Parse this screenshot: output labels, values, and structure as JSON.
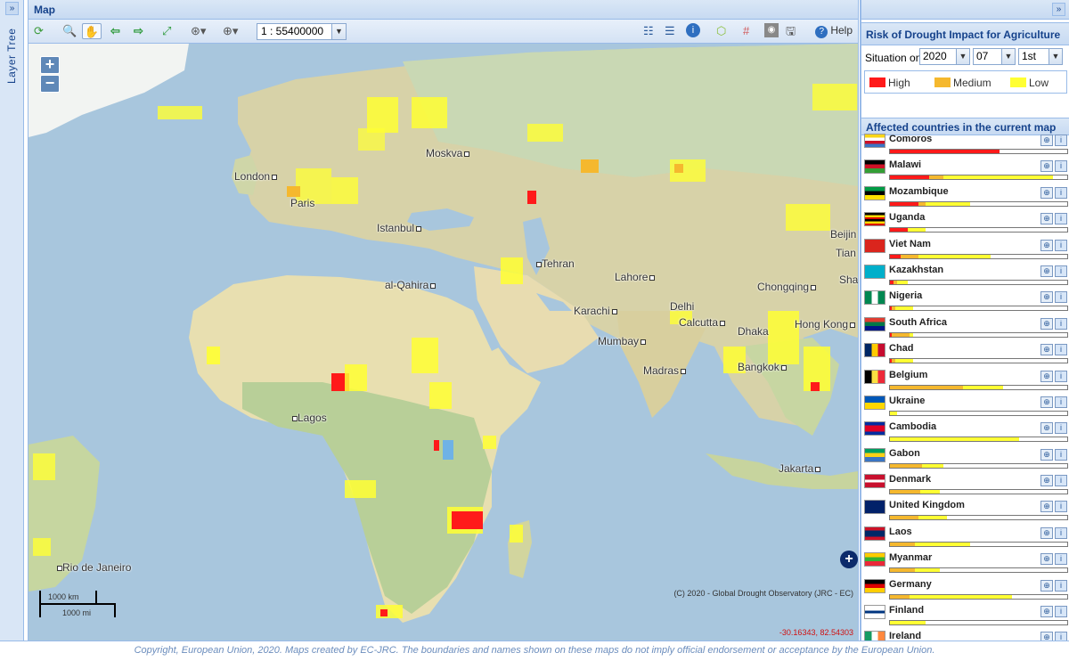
{
  "layer_tree": {
    "label": "Layer Tree",
    "expand": "»"
  },
  "map": {
    "title": "Map",
    "scale": "1 : 55400000",
    "help_label": "Help",
    "attribution": "(C) 2020 - Global Drought Observatory (JRC - EC)",
    "coordinates": "-30.16343, 82.54303",
    "zoom_in": "+",
    "zoom_out": "−",
    "scalebar_km": "1000 km",
    "scalebar_mi": "1000 mi",
    "cities": [
      "Moskva",
      "London",
      "Paris",
      "Istanbul",
      "Tehran",
      "Lahore",
      "Beijin",
      "Tian",
      "Sha",
      "al-Qahira",
      "Chongqing",
      "Karachi",
      "Delhi",
      "Calcutta",
      "Dhaka",
      "Hong Kong",
      "Mumbay",
      "Madras",
      "Bangkok",
      "Lagos",
      "Jakarta",
      "Rio de Janeiro"
    ]
  },
  "panel": {
    "expand": "»",
    "title": "Risk of Drought Impact for Agriculture",
    "situation_label": "Situation on:",
    "year": "2020",
    "month": "07",
    "dekad": "1st",
    "legend": [
      {
        "label": "High",
        "color": "#ff1a1a"
      },
      {
        "label": "Medium",
        "color": "#f5b82e"
      },
      {
        "label": "Low",
        "color": "#ffff33"
      }
    ],
    "affected_title": "Affected countries in the current map"
  },
  "countries": [
    {
      "name": "Comoros",
      "high": 0.62,
      "medium": 0.0,
      "low": 0.0
    },
    {
      "name": "Malawi",
      "high": 0.22,
      "medium": 0.08,
      "low": 0.62
    },
    {
      "name": "Mozambique",
      "high": 0.16,
      "medium": 0.04,
      "low": 0.25
    },
    {
      "name": "Uganda",
      "high": 0.1,
      "medium": 0.0,
      "low": 0.1
    },
    {
      "name": "Viet Nam",
      "high": 0.06,
      "medium": 0.1,
      "low": 0.41
    },
    {
      "name": "Kazakhstan",
      "high": 0.02,
      "medium": 0.02,
      "low": 0.06
    },
    {
      "name": "Nigeria",
      "high": 0.01,
      "medium": 0.02,
      "low": 0.1
    },
    {
      "name": "South Africa",
      "high": 0.01,
      "medium": 0.1,
      "low": 0.02
    },
    {
      "name": "Chad",
      "high": 0.01,
      "medium": 0.02,
      "low": 0.1
    },
    {
      "name": "Belgium",
      "high": 0.0,
      "medium": 0.41,
      "low": 0.23
    },
    {
      "name": "Ukraine",
      "high": 0.0,
      "medium": 0.0,
      "low": 0.04
    },
    {
      "name": "Cambodia",
      "high": 0.0,
      "medium": 0.0,
      "low": 0.73
    },
    {
      "name": "Gabon",
      "high": 0.0,
      "medium": 0.18,
      "low": 0.12
    },
    {
      "name": "Denmark",
      "high": 0.0,
      "medium": 0.17,
      "low": 0.11
    },
    {
      "name": "United Kingdom",
      "high": 0.0,
      "medium": 0.16,
      "low": 0.16
    },
    {
      "name": "Laos",
      "high": 0.0,
      "medium": 0.14,
      "low": 0.31
    },
    {
      "name": "Myanmar",
      "high": 0.0,
      "medium": 0.14,
      "low": 0.14
    },
    {
      "name": "Germany",
      "high": 0.0,
      "medium": 0.11,
      "low": 0.58
    },
    {
      "name": "Finland",
      "high": 0.0,
      "medium": 0.0,
      "low": 0.2
    },
    {
      "name": "Ireland",
      "high": 0.0,
      "medium": 0.1,
      "low": 0.1
    }
  ],
  "footer": "Copyright, European Union, 2020. Maps created by EC-JRC. The boundaries and names shown on these maps do not imply official endorsement or acceptance by the European Union."
}
